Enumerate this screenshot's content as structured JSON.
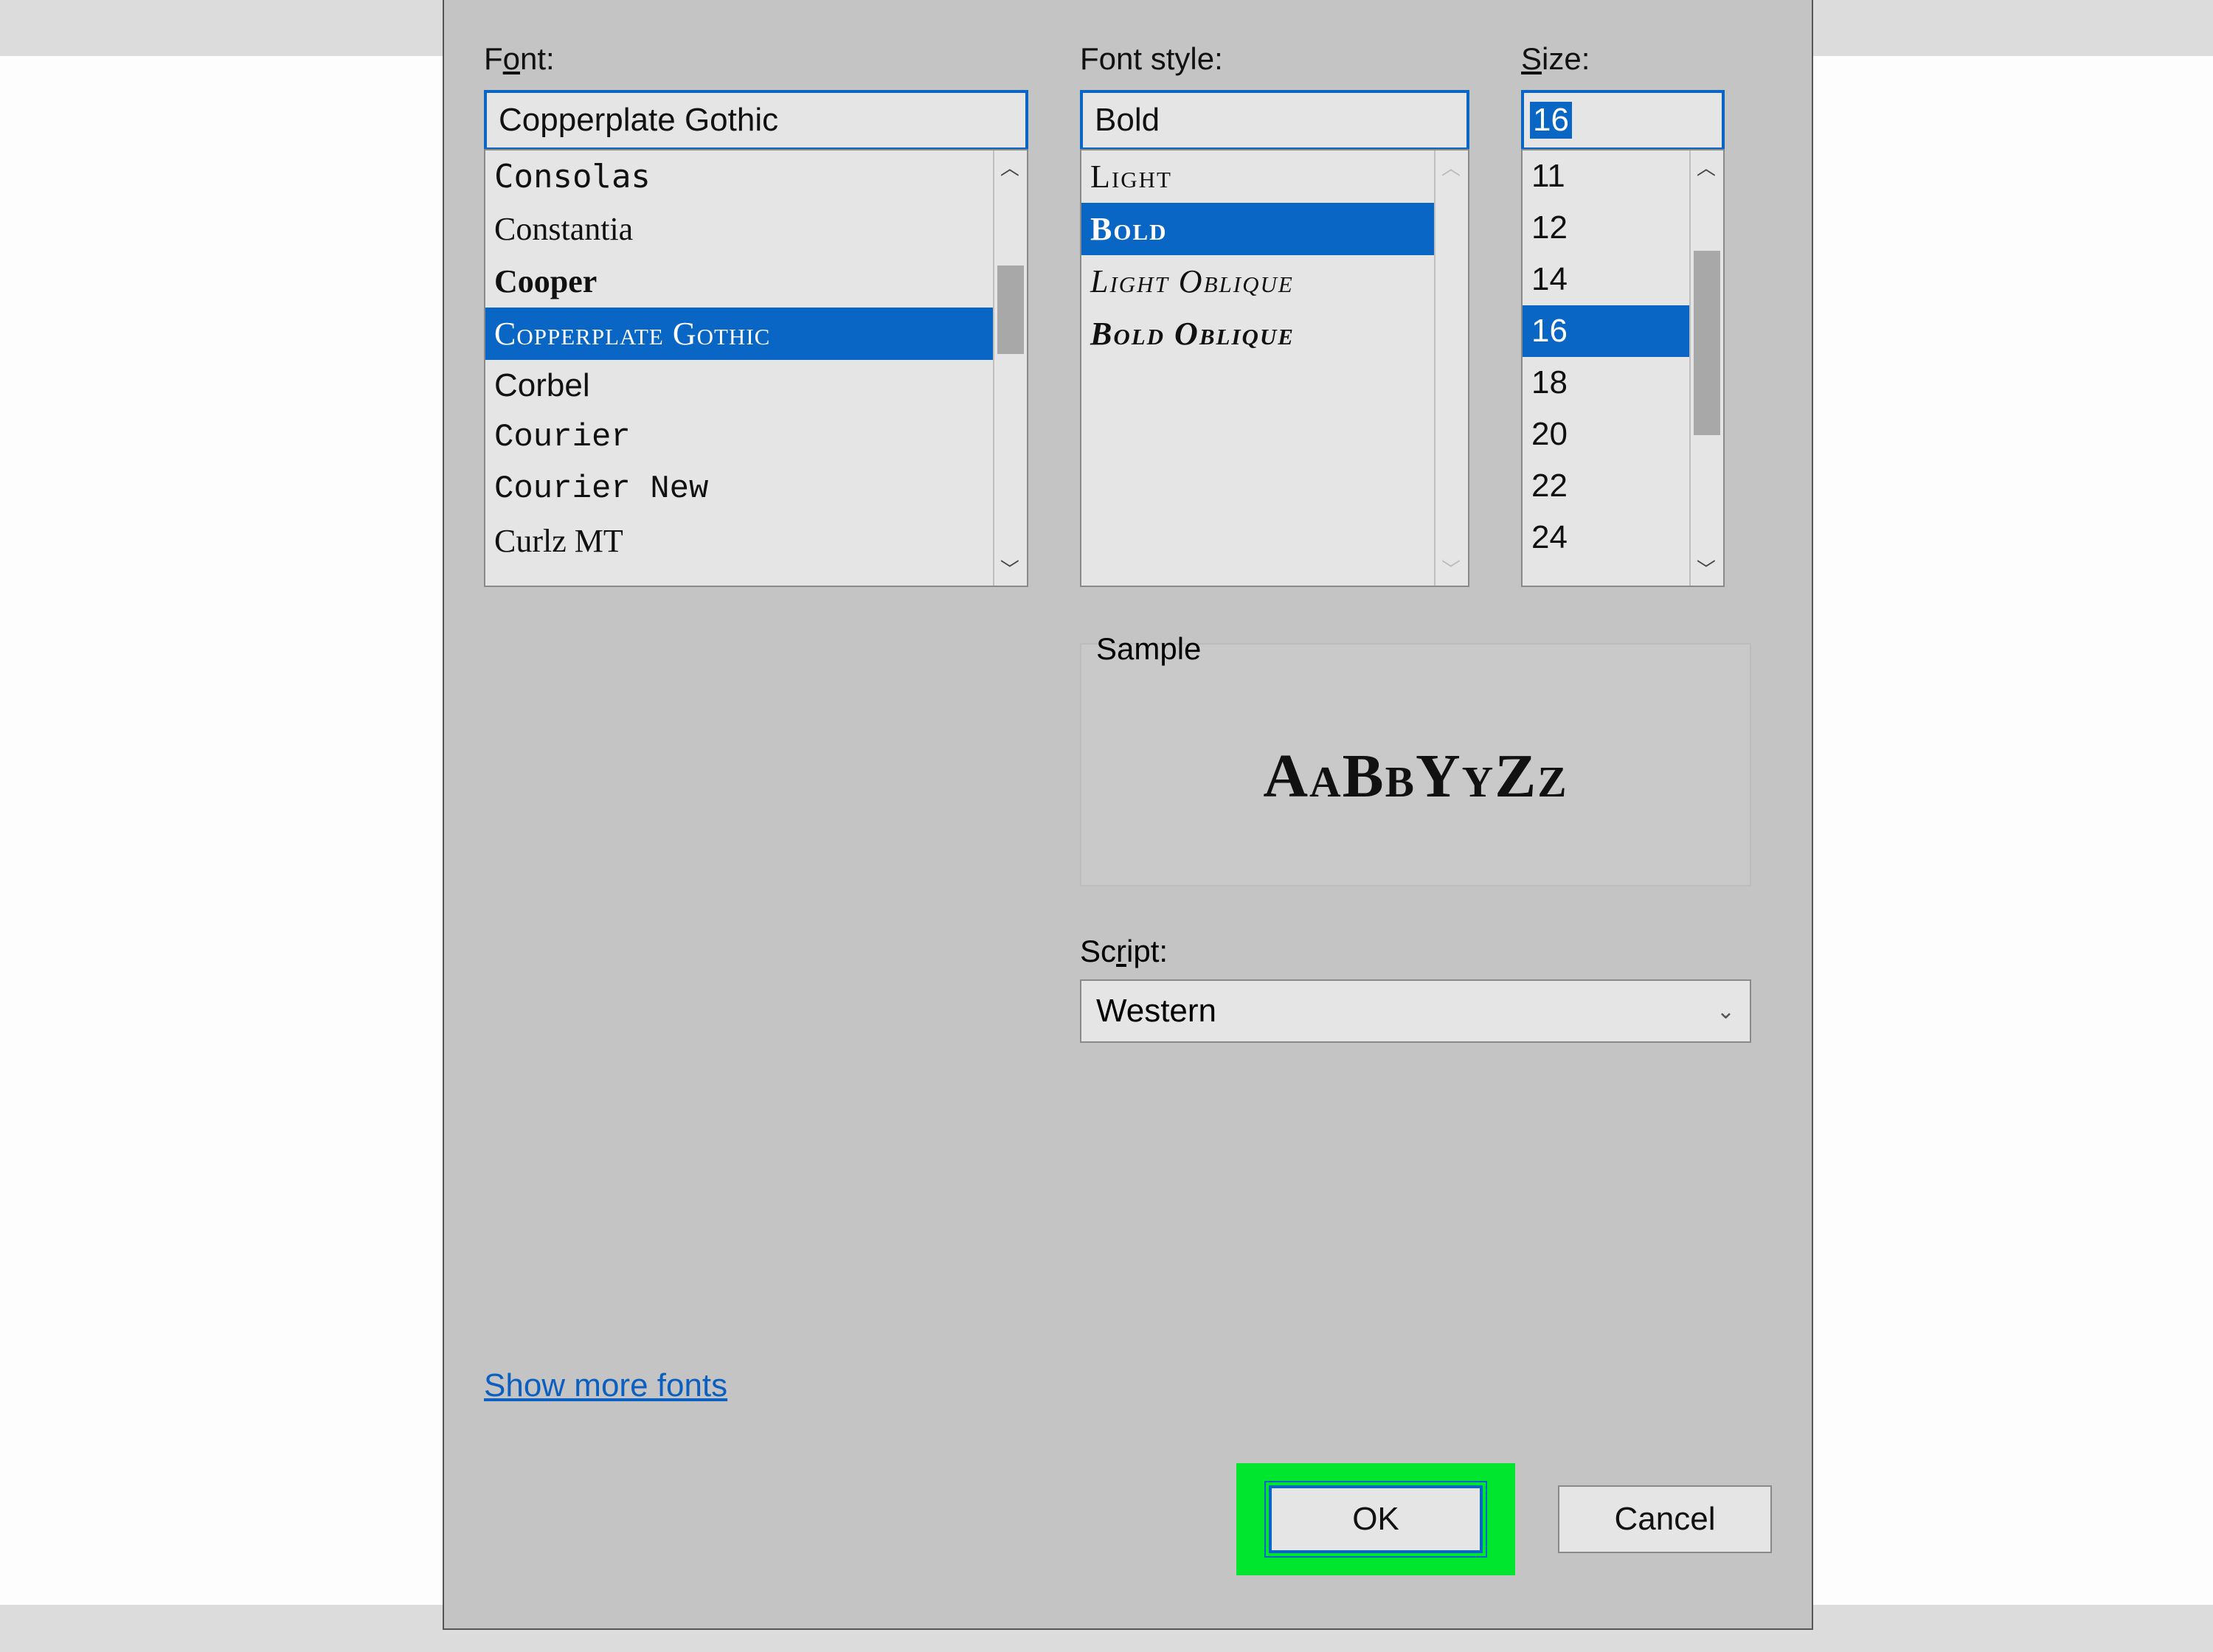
{
  "labels": {
    "font_pre": "F",
    "font_ul": "o",
    "font_post": "nt:",
    "style": "Font style:",
    "size_pre": "",
    "size_ul": "S",
    "size_post": "ize:",
    "sample": "Sample",
    "script_pre": "Sc",
    "script_ul": "r",
    "script_post": "ipt:"
  },
  "font": {
    "value": "Copperplate Gothic",
    "items": [
      "Consolas",
      "Constantia",
      "Cooper",
      "Copperplate Gothic",
      "Corbel",
      "Courier",
      "Courier New",
      "Curlz MT"
    ],
    "selected_index": 3
  },
  "style": {
    "value": "Bold",
    "items": [
      "Light",
      "Bold",
      "Light Oblique",
      "Bold Oblique"
    ],
    "selected_index": 1
  },
  "size": {
    "value": "16",
    "items": [
      "11",
      "12",
      "14",
      "16",
      "18",
      "20",
      "22",
      "24"
    ],
    "selected_index": 3
  },
  "sample_text": "AaBbYyZz",
  "script_value": "Western",
  "link_text": "Show more fonts",
  "buttons": {
    "ok": "OK",
    "cancel": "Cancel"
  }
}
